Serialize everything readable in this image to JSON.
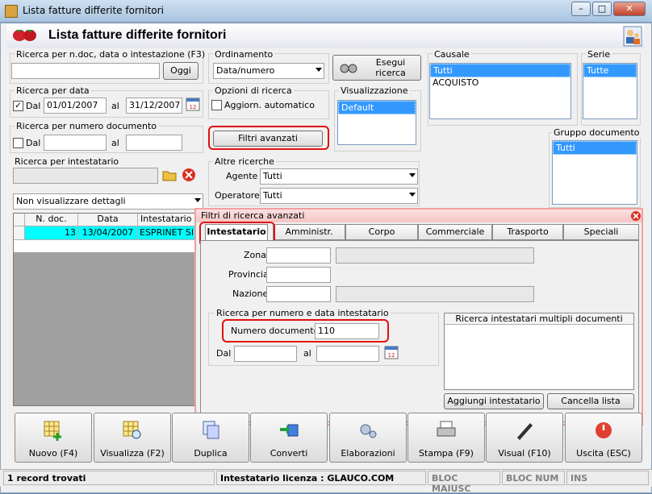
{
  "window": {
    "title": "Lista fatture differite fornitori"
  },
  "header": {
    "title": "Lista fatture differite fornitori"
  },
  "search_text": {
    "group_label": "Ricerca per n.doc, data o intestazione (F3)",
    "value": "",
    "oggi_button": "Oggi"
  },
  "search_date": {
    "group_label": "Ricerca per data",
    "dal_label": "Dal",
    "dal_checked": true,
    "dal_value": "01/01/2007",
    "al_label": "al",
    "al_value": "31/12/2007"
  },
  "search_number": {
    "group_label": "Ricerca per numero documento",
    "dal_label": "Dal",
    "dal_checked": false,
    "al_label": "al"
  },
  "search_holder": {
    "group_label": "Ricerca per intestatario"
  },
  "details_combo": {
    "value": "Non visualizzare dettagli"
  },
  "ordering": {
    "group_label": "Ordinamento",
    "value": "Data/numero"
  },
  "execute_button": {
    "line1": "Esegui",
    "line2": "ricerca"
  },
  "search_options": {
    "group_label": "Opzioni di ricerca",
    "auto_update_label": "Aggiorn. automatico",
    "auto_update_checked": false
  },
  "advanced_filters_button": "Filtri avanzati",
  "visualization": {
    "group_label": "Visualizzazione",
    "items": [
      "Default"
    ]
  },
  "other_searches": {
    "group_label": "Altre ricerche",
    "agent_label": "Agente :",
    "agent_value": "Tutti",
    "operator_label": "Operatore :",
    "operator_value": "Tutti"
  },
  "causale": {
    "group_label": "Causale",
    "items": [
      "Tutti",
      "ACQUISTO"
    ]
  },
  "serie": {
    "group_label": "Serie",
    "items": [
      "Tutte"
    ]
  },
  "gruppo_documento": {
    "group_label": "Gruppo documento",
    "items": [
      "Tutti"
    ]
  },
  "table": {
    "columns": [
      "N. doc.",
      "Data",
      "Intestatario"
    ],
    "rows": [
      {
        "ndoc": "13",
        "data": "13/04/2007",
        "intestatario": "ESPRINET SI"
      }
    ]
  },
  "advanced_panel": {
    "title": "Filtri di ricerca avanzati",
    "tabs": [
      "Intestatario",
      "Amministr.",
      "Corpo",
      "Commerciale",
      "Trasporto",
      "Speciali"
    ],
    "zona_label": "Zona",
    "provincia_label": "Provincia",
    "nazione_label": "Nazione",
    "number_group_label": "Ricerca per numero e data intestatario",
    "numero_documento_label": "Numero documento :",
    "numero_documento_value": "110",
    "dal_label": "Dal",
    "al_label": "al",
    "multi_group_label": "Ricerca intestatari multipli documenti",
    "add_button": "Aggiungi intestatario",
    "cancel_list_button": "Cancella lista"
  },
  "toolbar": [
    "Nuovo (F4)",
    "Visualizza (F2)",
    "Duplica",
    "Converti",
    "Elaborazioni",
    "Stampa (F9)",
    "Visual (F10)",
    "Uscita (ESC)"
  ],
  "status": {
    "records": "1 record trovati",
    "license": "Intestatario licenza : GLAUCO.COM",
    "caps": "BLOC MAIUSC",
    "num": "BLOC NUM",
    "ins": "INS"
  },
  "colors": {
    "selection": "#3399ff",
    "row_highlight": "#00ffff",
    "highlight_box": "#e01010"
  }
}
